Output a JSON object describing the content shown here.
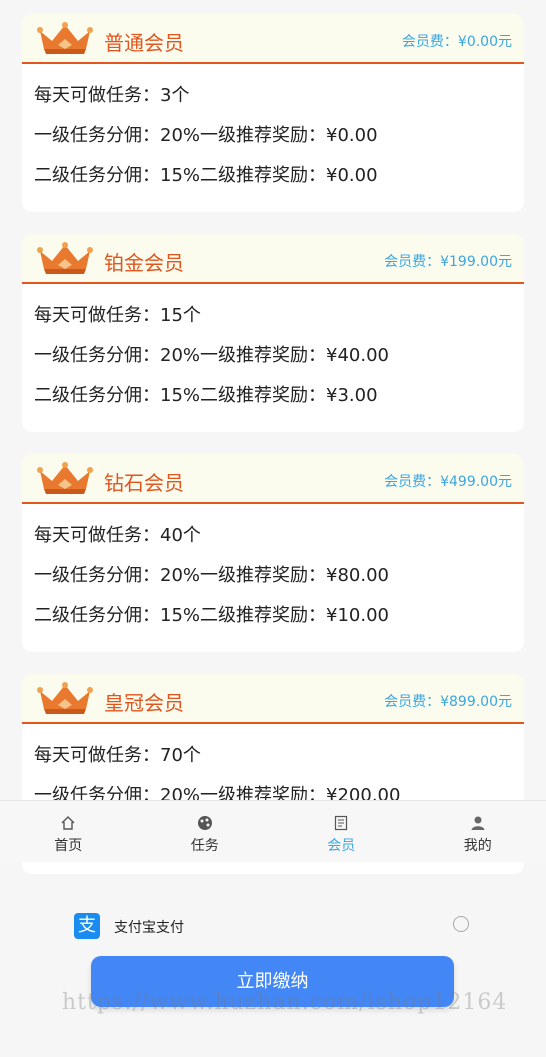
{
  "levels": [
    {
      "name": "普通会员",
      "fee": "会员费：¥0.00元",
      "daily": "每天可做任务：3个",
      "tier1": "一级任务分佣：20%一级推荐奖励：¥0.00",
      "tier2": "二级任务分佣：15%二级推荐奖励：¥0.00"
    },
    {
      "name": "铂金会员",
      "fee": "会员费：¥199.00元",
      "daily": "每天可做任务：15个",
      "tier1": "一级任务分佣：20%一级推荐奖励：¥40.00",
      "tier2": "二级任务分佣：15%二级推荐奖励：¥3.00"
    },
    {
      "name": "钻石会员",
      "fee": "会员费：¥499.00元",
      "daily": "每天可做任务：40个",
      "tier1": "一级任务分佣：20%一级推荐奖励：¥80.00",
      "tier2": "二级任务分佣：15%二级推荐奖励：¥10.00"
    },
    {
      "name": "皇冠会员",
      "fee": "会员费：¥899.00元",
      "daily": "每天可做任务：70个",
      "tier1": "一级任务分佣：20%一级推荐奖励：¥200.00",
      "tier2": ""
    }
  ],
  "tabbar": {
    "tabs": [
      {
        "label": "首页",
        "icon": "home-icon"
      },
      {
        "label": "任务",
        "icon": "task-icon"
      },
      {
        "label": "会员",
        "icon": "member-icon",
        "active": true
      },
      {
        "label": "我的",
        "icon": "profile-icon"
      }
    ]
  },
  "payment": {
    "method_label": "支付宝支付",
    "icon_glyph": "支",
    "submit_label": "立即缴纳"
  },
  "watermark": "https://www.huzhan.com/ishop12164",
  "colors": {
    "accent": "#e2551d",
    "fee": "#3aa7e0",
    "button": "#4387f6",
    "active_tab": "#3aa7e0"
  }
}
